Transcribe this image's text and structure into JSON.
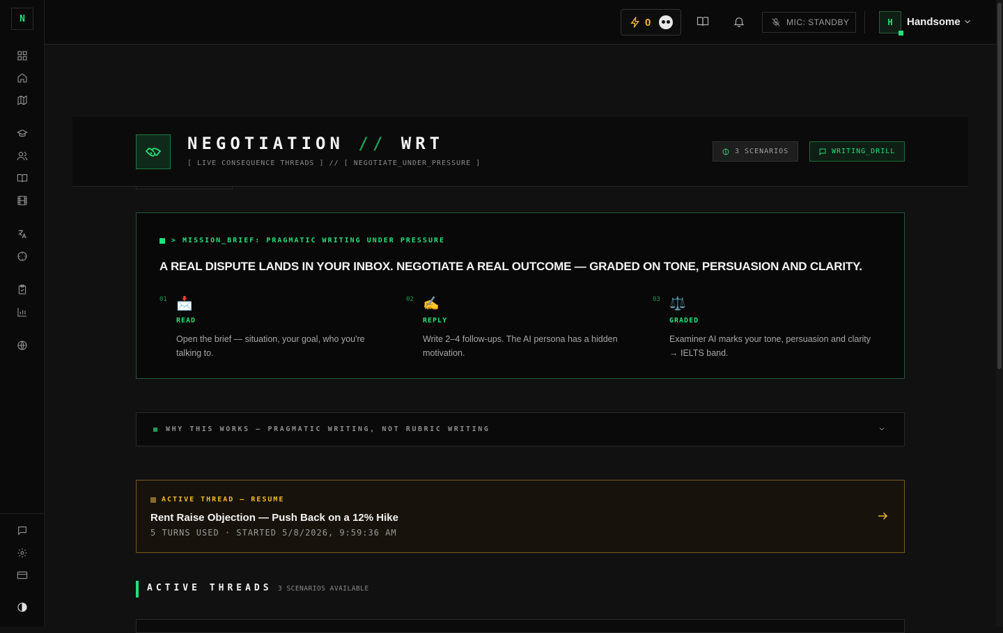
{
  "app": {
    "logo_letter": "N"
  },
  "sidebar": {
    "items": [
      {
        "name": "dashboard-icon"
      },
      {
        "name": "home-icon"
      },
      {
        "name": "map-icon"
      },
      {
        "name": "graduation-cap-icon"
      },
      {
        "name": "users-icon"
      },
      {
        "name": "book-icon"
      },
      {
        "name": "film-icon"
      },
      {
        "name": "translate-icon"
      },
      {
        "name": "target-icon"
      },
      {
        "name": "clipboard-icon"
      },
      {
        "name": "bar-chart-icon"
      },
      {
        "name": "globe-icon"
      },
      {
        "name": "message-icon"
      },
      {
        "name": "settings-icon"
      },
      {
        "name": "credit-card-icon"
      },
      {
        "name": "contrast-icon"
      }
    ]
  },
  "topbar": {
    "xp_value": "0",
    "mic_label": "MIC: STANDBY",
    "user_initial": "H",
    "user_name": "Handsome"
  },
  "hero": {
    "title_a": "NEGOTIATION",
    "title_sep": "//",
    "title_b": "WRT",
    "subtitle": "[ LIVE CONSEQUENCE THREADS ] // [ NEGOTIATE_UNDER_PRESSURE ]",
    "badge_scenarios": "3 SCENARIOS",
    "badge_mode": "WRITING_DRILL"
  },
  "brief": {
    "label": "> MISSION_BRIEF: PRAGMATIC WRITING UNDER PRESSURE",
    "headline": "A REAL DISPUTE LANDS IN YOUR INBOX. NEGOTIATE A REAL OUTCOME — GRADED ON TONE, PERSUASION AND CLARITY.",
    "steps": [
      {
        "num": "01",
        "emoji": "📩",
        "title": "READ",
        "desc": "Open the brief — situation, your goal, who you're talking to."
      },
      {
        "num": "02",
        "emoji": "✍️",
        "title": "REPLY",
        "desc": "Write 2–4 follow-ups. The AI persona has a hidden motivation."
      },
      {
        "num": "03",
        "emoji": "⚖️",
        "title": "GRADED",
        "desc": "Examiner AI marks your tone, persuasion and clarity → IELTS band."
      }
    ]
  },
  "why": {
    "label": "WHY THIS WORKS — PRAGMATIC WRITING, NOT RUBRIC WRITING"
  },
  "resume": {
    "label": "ACTIVE THREAD — RESUME",
    "title": "Rent Raise Objection — Push Back on a 12% Hike",
    "meta": "5 TURNS USED · STARTED 5/8/2026, 9:59:36 AM"
  },
  "section": {
    "title": "ACTIVE THREADS",
    "count": "3 SCENARIOS AVAILABLE"
  },
  "colors": {
    "accent": "#22e07a",
    "warning": "#f5b82e",
    "background": "#111111"
  }
}
